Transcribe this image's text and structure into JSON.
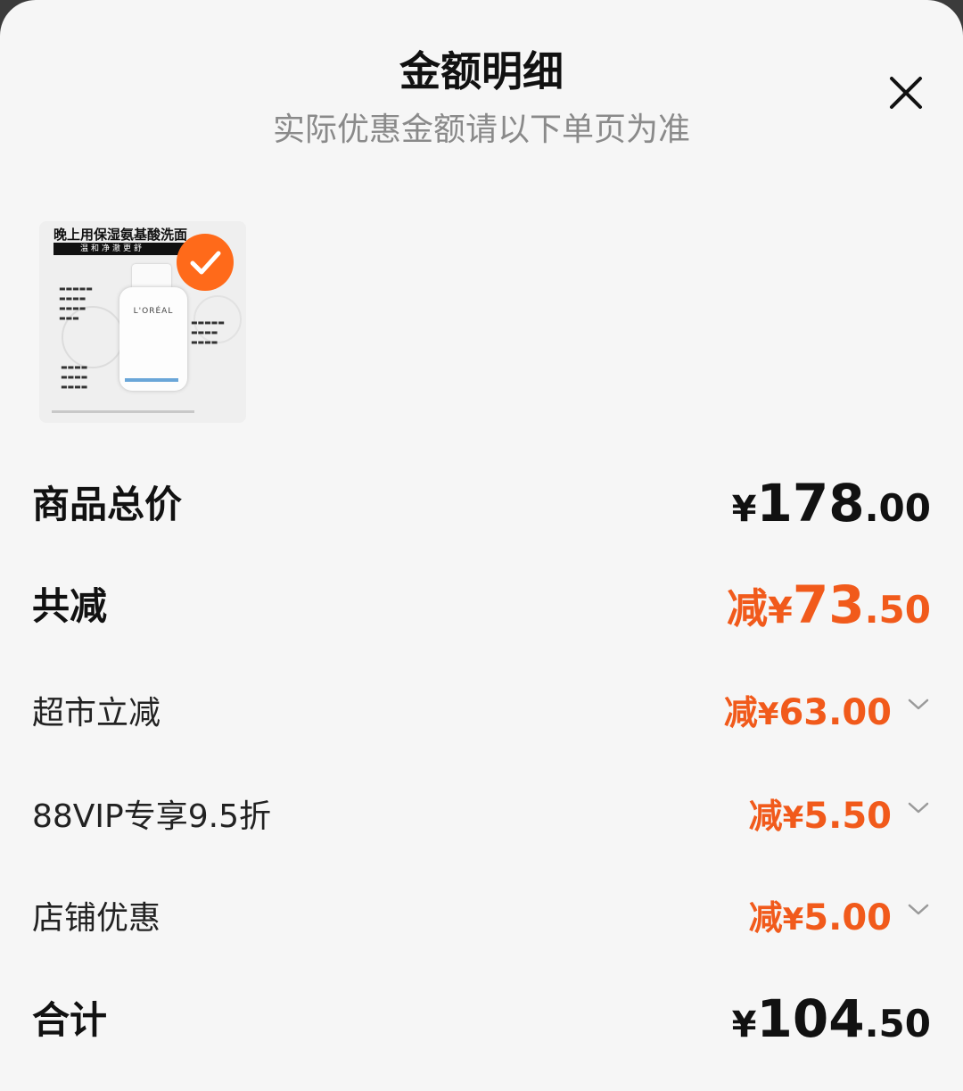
{
  "header": {
    "title": "金额明细",
    "subtitle": "实际优惠金额请以下单页为准"
  },
  "product": {
    "image_heading": "晚上用保湿氨基酸洗面",
    "image_band": "温和净澈更舒",
    "image_brand": "L'ORÉAL",
    "selected": true
  },
  "rows": {
    "total_price": {
      "label": "商品总价",
      "currency": "¥",
      "integer": "178",
      "decimal": ".00"
    },
    "total_discount": {
      "label": "共减",
      "prefix": "减",
      "currency": "¥",
      "integer": "73",
      "decimal": ".50"
    },
    "supermarket": {
      "label": "超市立减",
      "prefix": "减",
      "currency": "¥",
      "integer": "63",
      "decimal": ".00"
    },
    "vip": {
      "label": "88VIP专享9.5折",
      "prefix": "减",
      "currency": "¥",
      "integer": "5",
      "decimal": ".50"
    },
    "shop": {
      "label": "店铺优惠",
      "prefix": "减",
      "currency": "¥",
      "integer": "5",
      "decimal": ".00"
    },
    "sum": {
      "label": "合计",
      "currency": "¥",
      "integer": "104",
      "decimal": ".50"
    }
  },
  "colors": {
    "accent": "#f15a1b",
    "checkmark_badge": "#ff6a1a",
    "text_primary": "#111111",
    "text_secondary": "#8a8a8a",
    "sheet_bg": "#f6f6f6"
  },
  "icons": [
    "close-icon",
    "check-icon",
    "chevron-down-icon"
  ]
}
